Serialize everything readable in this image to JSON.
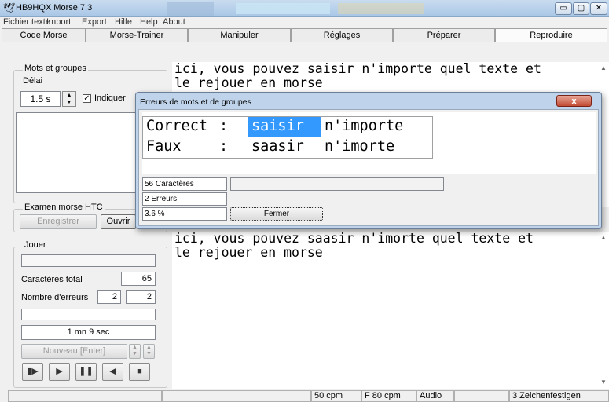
{
  "window": {
    "title": "HB9HQX Morse 7.3"
  },
  "menu": [
    "Fichier texte",
    "Import",
    "Export",
    "Hilfe",
    "Help",
    "About"
  ],
  "tabs": [
    "Code Morse",
    "Morse-Trainer",
    "Manipuler",
    "Réglages",
    "Préparer",
    "Reproduire"
  ],
  "left": {
    "mots_group": "Mots et groupes",
    "delai_label": "Délai",
    "delai_value": "1.5 s",
    "indiquer_label": "Indiquer",
    "indiquer_checked": true,
    "examen_group": "Examen morse HTC",
    "enregistrer": "Enregistrer",
    "ouvrir": "Ouvrir",
    "jouer_group": "Jouer",
    "caracteres_total_label": "Caractères total",
    "caracteres_total_value": "65",
    "nombre_erreurs_label": "Nombre d'erreurs",
    "nombre_erreurs_a": "2",
    "nombre_erreurs_b": "2",
    "time": "1 mn 9 sec",
    "nouveau": "Nouveau  [Enter]"
  },
  "upper_text": "ici, vous pouvez saisir n'importe quel texte et\nle rejouer en morse",
  "lower_text": "ici, vous pouvez saasir n'imorte quel texte et\nle rejouer en morse",
  "dialog": {
    "title": "Erreurs de mots et de groupes",
    "close_glyph": "x",
    "rows": [
      {
        "label": "Correct",
        "sep": ":",
        "words": [
          "saisir",
          "n'importe"
        ]
      },
      {
        "label": "Faux",
        "sep": ":",
        "words": [
          "saasir",
          "n'imorte"
        ]
      }
    ],
    "chars": "56 Caractères",
    "errors": "2 Erreurs",
    "percent": "3.6 %",
    "fermer": "Fermer"
  },
  "status": {
    "cpm": "50 cpm",
    "fcpm": "F 80 cpm",
    "audio": "Audio",
    "zeichen": "3 Zeichenfestigen"
  },
  "icons": {
    "app": "dove-icon",
    "transport": [
      "play-step-icon",
      "play-icon",
      "pause-icon",
      "back-icon",
      "stop-icon"
    ]
  }
}
